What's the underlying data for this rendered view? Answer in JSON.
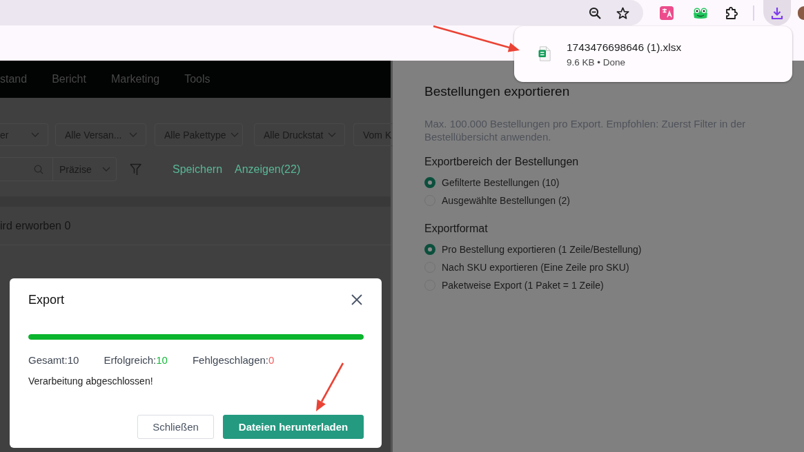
{
  "download_popup": {
    "file_name": "1743476698646 (1).xlsx",
    "details": "9.6 KB • Done"
  },
  "nav": {
    "items": [
      "stand",
      "Bericht",
      "Marketing",
      "Tools"
    ]
  },
  "filters": [
    "er",
    "Alle Versan...",
    "Alle Pakettype",
    "Alle Druckstat",
    "Vom K"
  ],
  "search": {
    "mode": "Präzise"
  },
  "links": [
    "Speichern",
    "Anzeigen(22)"
  ],
  "summary": "ird erworben 0",
  "drawer": {
    "title": "Bestellungen exportieren",
    "hint": "Max. 100.000 Bestellungen pro Export. Empfohlen: Zuerst Filter in der Bestellübersicht anwenden.",
    "sections": [
      {
        "heading": "Exportbereich der Bestellungen",
        "options": [
          {
            "label": "Gefilterte Bestellungen (10)",
            "selected": true
          },
          {
            "label": "Ausgewählte Bestellungen (2)",
            "selected": false
          }
        ]
      },
      {
        "heading": "Exportformat",
        "options": [
          {
            "label": "Pro Bestellung exportieren (1 Zeile/Bestellung)",
            "selected": true
          },
          {
            "label": "Nach SKU exportieren (Eine Zeile pro SKU)",
            "selected": false
          },
          {
            "label": "Paketweise Export (1 Paket = 1 Zeile)",
            "selected": false
          }
        ]
      }
    ]
  },
  "dialog": {
    "title": "Export",
    "progress": {
      "level": 1
    },
    "stats": [
      {
        "label": "Gesamt:",
        "value": "10",
        "kind": "total"
      },
      {
        "label": "Erfolgreich:",
        "value": "10",
        "kind": "success"
      },
      {
        "label": "Fehlgeschlagen:",
        "value": "0",
        "kind": "failure"
      }
    ],
    "message": "Verarbeitung abgeschlossen!",
    "buttons": [
      {
        "label": "Schließen",
        "kind": "secondary"
      },
      {
        "label": "Dateien herunterladen",
        "kind": "primary"
      }
    ]
  }
}
